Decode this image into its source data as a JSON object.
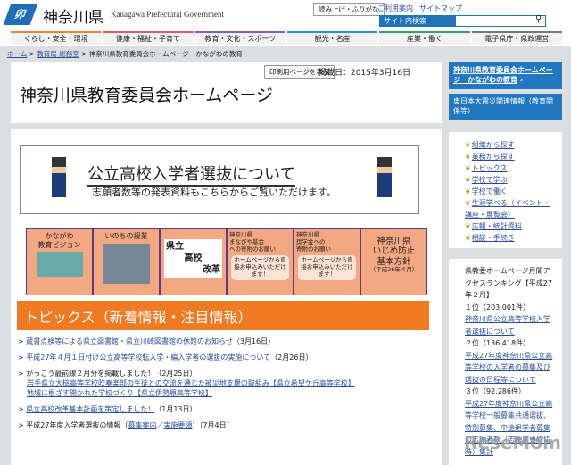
{
  "header": {
    "logo_mark": "卯",
    "logo_text": "神奈川県",
    "logo_en": "Kanagawa Prefectural Government",
    "read_aloud": "読み上げ・ふりがな",
    "guide": "ご利用案内",
    "sitemap": "サイトマップ",
    "search_label": "サイト内検索",
    "search_value": ""
  },
  "nav": [
    {
      "label": "くらし・安全・環境",
      "color": "#e8833a"
    },
    {
      "label": "健康・福祉・子育て",
      "color": "#e05a6a"
    },
    {
      "label": "教育・文化・スポーツ",
      "color": "#8a5cb8"
    },
    {
      "label": "観光・名産",
      "color": "#2d8fd6"
    },
    {
      "label": "産業・働く",
      "color": "#2fa36b"
    },
    {
      "label": "電子県庁・県政運営",
      "color": "#777777"
    }
  ],
  "breadcrumb": {
    "home": "ホーム",
    "section": "教育局 総務室",
    "current": "神奈川県教育委員会ホームページ　かながわの教育"
  },
  "page": {
    "print": "印刷用ページを表示",
    "date": "掲載日：2015年3月16日",
    "title": "神奈川県教育委員会ホームページ"
  },
  "banner": {
    "title": "公立高校入学者選抜について",
    "sub": "志願者数等の発表資料もこちらからご覧いただけます。"
  },
  "tiles": [
    {
      "l1": "かながわ",
      "l2": "教育ビジョン"
    },
    {
      "l1": "いのちの授業"
    },
    {
      "l1": "県立",
      "l2": "高校",
      "l3": "改革"
    },
    {
      "l1": "神奈川県",
      "l2": "まなびや基金",
      "l3": "への寄附のお願い",
      "bubble": "ホームページから直接お申込みいただけます！"
    },
    {
      "l1": "神奈川県",
      "l2": "奨学金への",
      "l3": "寄附のお願い",
      "bubble": "ホームページから直接お申込みいただけます！"
    },
    {
      "l1": "神奈川県",
      "l2": "いじめ防止",
      "l3": "基本方針",
      "l4": "（平成26年４月）"
    }
  ],
  "topics": {
    "title": "トピックス（新着情報・注目情報）",
    "items": [
      {
        "link": "蔵書点検等による県立図書館・県立川崎図書館の休館のお知らせ",
        "date": "（3月16日）"
      },
      {
        "link": "平成27年４月１日付け公立高等学校転入学・編入学者の選抜の実施について",
        "date": "（2月26日）"
      },
      {
        "text": "がっこう最前線２月分を掲載しました！（2月25日）",
        "sub1": "岩手県立大槌高等学校吹奏楽部の生徒との交流を通じた被災地支援の取組み【県立希望ケ丘高等学校】",
        "sub2": "地域に根ざす開かれた学校づくり【県立伊勢原高等学校】"
      },
      {
        "link": "県立高校改革基本計画を策定しました！",
        "date": "（1月13日）"
      },
      {
        "text": "平成27年度入学者選抜の情報（",
        "l1": "募集案内",
        "sep": "／",
        "l2": "実施要領",
        "date": "）（7月4日）"
      }
    ]
  },
  "sidebar": {
    "blue1": "神奈川県教育委員会ホームページ　かながわの教育",
    "blue2": "東日本大震災関連情報（教育関係等）",
    "menu": [
      "組織から探す",
      "業務から探す",
      "トピックス",
      "学校で学ぶ",
      "学校で働く",
      "生涯学べる（イベント・講座・展覧会）",
      "広報・統計資料",
      "相談・手続き"
    ],
    "ranking": {
      "title": "県教委ホームページ月間アクセスランキング【平成27年２月】",
      "items": [
        {
          "rank": "１位（203,001件）",
          "link": "神奈川県公立高等学校入学者選抜について"
        },
        {
          "rank": "２位（136,418件）",
          "link": "平成27年度神奈川県公立高等学校の入学者の募集及び選抜の日程等について"
        },
        {
          "rank": "３位（92,286件）",
          "link": "平成27年度神奈川県公立高等学校一般募集共通選抜、特別募集、中途退学者募集の志願者数（志願変更締切時）集計"
        }
      ]
    }
  },
  "watermark": "ReseMom"
}
